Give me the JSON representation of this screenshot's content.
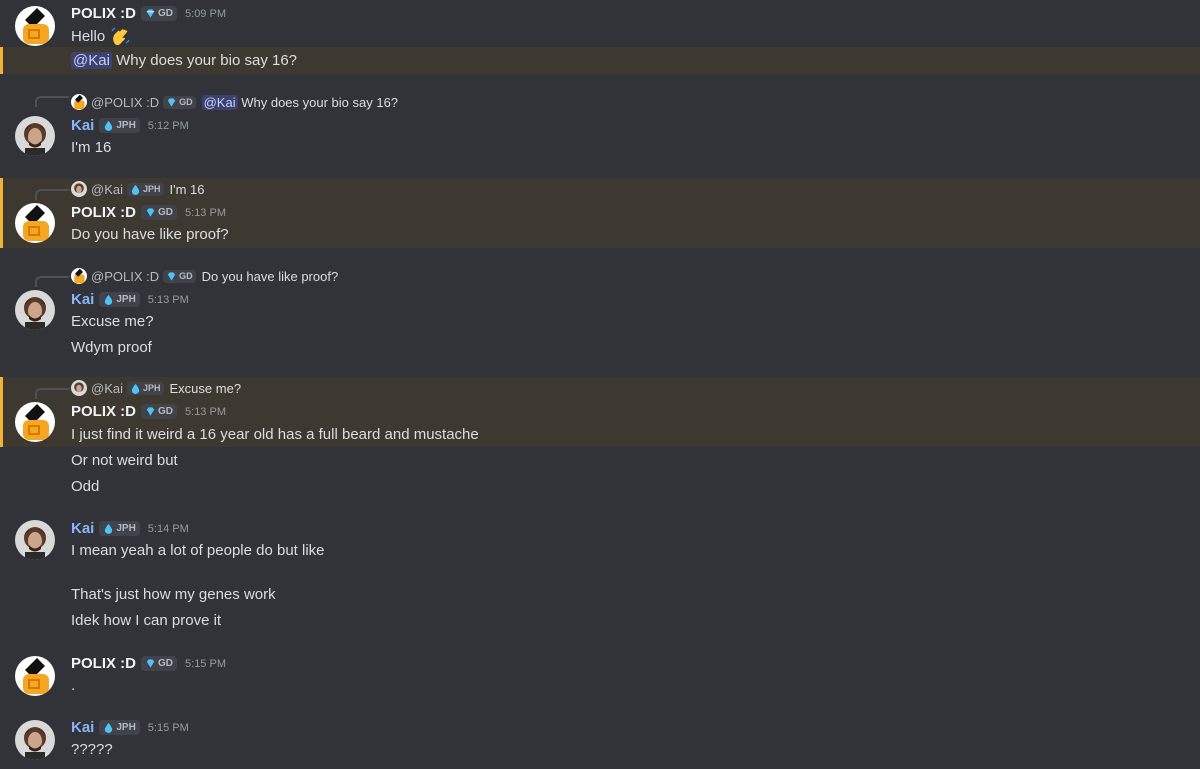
{
  "users": {
    "polix": {
      "name": "POLIX :D",
      "tag": "GD",
      "mention": "@POLIX :D"
    },
    "kai": {
      "name": "Kai",
      "tag": "JPH",
      "mention": "@Kai"
    }
  },
  "colors": {
    "background": "#313338",
    "highlight": "#3d3830",
    "highlight_border": "#f0b232",
    "kai_name": "#8ab4f8",
    "mention_bg": "#3c4270"
  },
  "messages": {
    "m1": {
      "time": "5:09 PM",
      "line1": "Hello",
      "line2_mention": "@Kai",
      "line2_text": "Why does your bio say 16?"
    },
    "m2": {
      "reply_text": "Why does your bio say 16?",
      "reply_mention": "@Kai",
      "time": "5:12 PM",
      "line1": "I'm 16"
    },
    "m3": {
      "reply_text": "I'm 16",
      "time": "5:13 PM",
      "line1": "Do you have like proof?"
    },
    "m4": {
      "reply_text": "Do you have like proof?",
      "time": "5:13 PM",
      "line1": "Excuse me?",
      "line2": "Wdym proof"
    },
    "m5": {
      "reply_text": "Excuse me?",
      "time": "5:13 PM",
      "line1": "I just find it weird a 16 year old has a full beard and mustache",
      "line2": "Or not weird but",
      "line3": "Odd"
    },
    "m6": {
      "time": "5:14 PM",
      "line1": "I mean yeah a lot of people do but like",
      "line2": "That's just how my genes work",
      "line3": "Idek how I can prove it"
    },
    "m7": {
      "time": "5:15 PM",
      "line1": "."
    },
    "m8": {
      "time": "5:15 PM",
      "line1": "?????"
    }
  }
}
